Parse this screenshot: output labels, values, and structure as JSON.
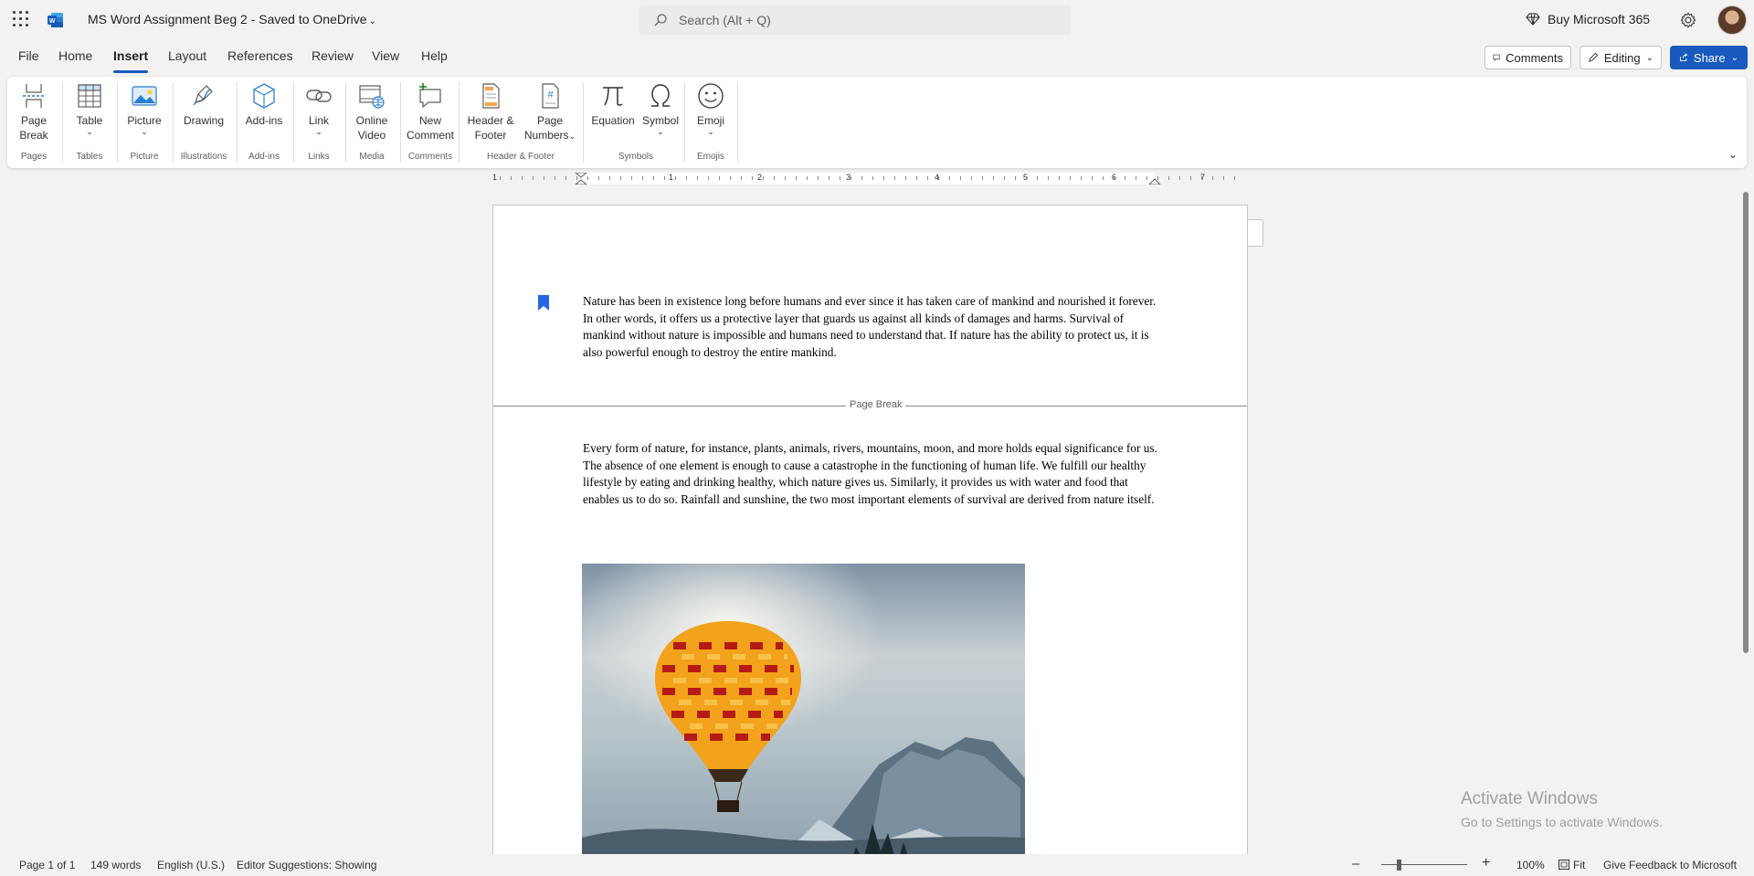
{
  "titlebar": {
    "doc_title": "MS Word Assignment Beg 2  -  Saved to OneDrive",
    "search_placeholder": "Search (Alt + Q)",
    "buy_label": "Buy Microsoft 365"
  },
  "menu": {
    "tabs": [
      "File",
      "Home",
      "Insert",
      "Layout",
      "References",
      "Review",
      "View",
      "Help"
    ],
    "active": "Insert",
    "comments_label": "Comments",
    "editing_label": "Editing",
    "share_label": "Share"
  },
  "ribbon": {
    "buttons": {
      "page_break": [
        "Page",
        "Break"
      ],
      "table": "Table",
      "picture": "Picture",
      "drawing": "Drawing",
      "addins": "Add-ins",
      "link": "Link",
      "online_video": [
        "Online",
        "Video"
      ],
      "new_comment": [
        "New",
        "Comment"
      ],
      "header_footer": [
        "Header &",
        "Footer"
      ],
      "page_numbers": [
        "Page",
        "Numbers"
      ],
      "equation": "Equation",
      "symbol": "Symbol",
      "emoji": "Emoji"
    },
    "groups": [
      "Pages",
      "Tables",
      "Picture",
      "Illustrations",
      "Add-ins",
      "Links",
      "Media",
      "Comments",
      "Header & Footer",
      "Symbols",
      "Emojis"
    ]
  },
  "ruler": {
    "numbers": [
      "1",
      "1",
      "2",
      "3",
      "4",
      "5",
      "6",
      "7"
    ]
  },
  "document": {
    "paragraph1": "Nature has been in existence long before humans and ever since it has taken care of mankind and nourished it forever. In other words, it offers us a protective layer that guards us against all kinds of damages and harms. Survival of mankind without nature is impossible and humans need to understand that. If nature has the ability to protect us, it is also powerful enough to destroy the entire mankind.",
    "page_break_label": "Page Break",
    "paragraph2": "Every form of nature, for instance, plants, animals, rivers, mountains, moon, and more holds equal significance for us. The absence of one element is enough to cause a catastrophe in the functioning of human life. We fulfill our healthy lifestyle by eating and drinking healthy, which nature gives us. Similarly, it provides us with water and food that enables us to do so. Rainfall and sunshine, the two most important elements of survival are derived from nature itself."
  },
  "statusbar": {
    "page": "Page 1 of 1",
    "words": "149 words",
    "language": "English (U.S.)",
    "editor": "Editor Suggestions: Showing",
    "zoom": "100%",
    "fit": "Fit",
    "feedback": "Give Feedback to Microsoft"
  },
  "watermark": {
    "line1": "Activate Windows",
    "line2": "Go to Settings to activate Windows."
  },
  "colors": {
    "accent": "#185abd",
    "word_blue": "#2b579a",
    "bookmark": "#2266e3"
  }
}
